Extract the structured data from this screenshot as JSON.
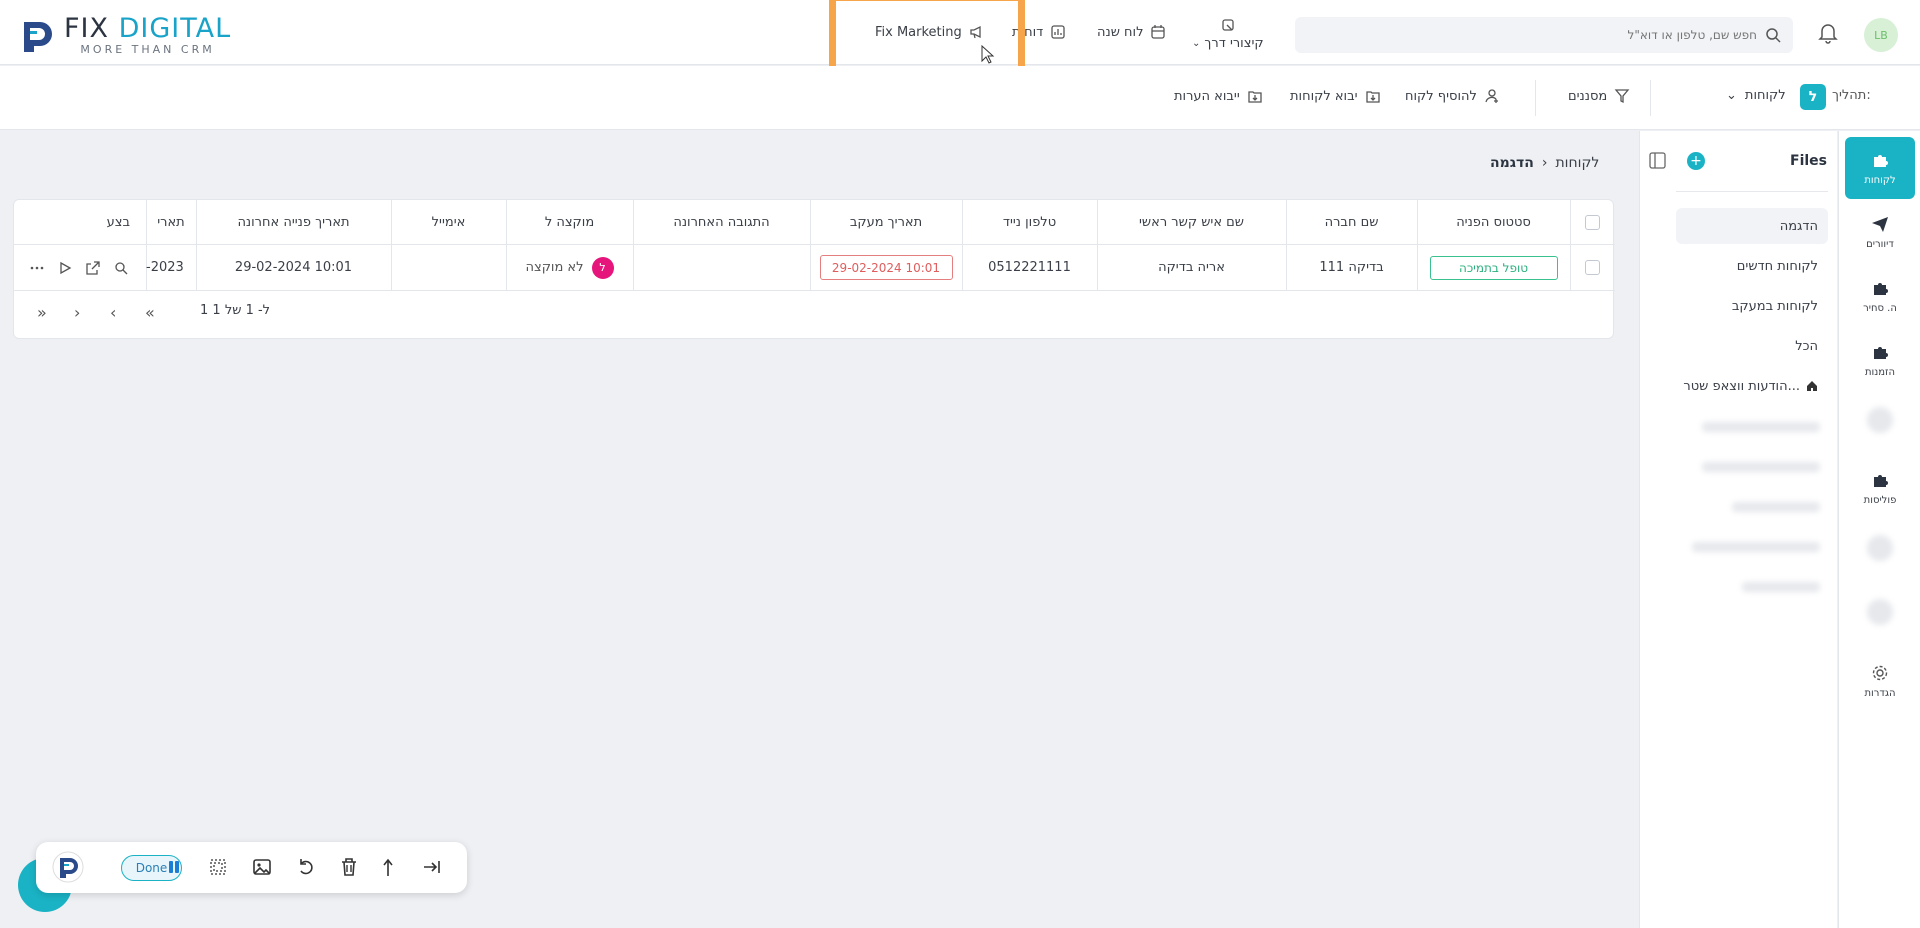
{
  "header": {
    "logo_brand_a": "FIX",
    "logo_brand_b": "DIGITAL",
    "logo_tagline": "MORE THAN CRM",
    "nav": [
      {
        "label": "Fix Marketing",
        "icon": "megaphone-icon"
      },
      {
        "label": "דוחות",
        "icon": "chart-icon"
      },
      {
        "label": "לוח שנה",
        "icon": "calendar-icon"
      },
      {
        "label": "קיצורי דרך",
        "icon": "shortcut-icon"
      }
    ],
    "search_placeholder": "חפש שם, טלפון או דוא\"ל",
    "avatar_initials": "LB"
  },
  "actionbar": {
    "process_label": "תהליך:",
    "process_chip": "ל",
    "process_name": "לקוחות",
    "filters": "מסננים",
    "add_customer": "להוסיף לקוח",
    "import_customers": "יבוא לקוחות",
    "import_notes": "ייבוא הערות"
  },
  "rail": [
    {
      "label": "לקוחות",
      "icon": "puzzle-icon",
      "active": true
    },
    {
      "label": "דיוורים",
      "icon": "send-icon"
    },
    {
      "label": "ה. סחיר",
      "icon": "puzzle-icon"
    },
    {
      "label": "הזמנות",
      "icon": "puzzle-icon"
    },
    {
      "label": "פוליסות",
      "icon": "puzzle-icon"
    },
    {
      "label": "הגדרות",
      "icon": "gear-icon"
    }
  ],
  "files_panel": {
    "title": "Files",
    "items": [
      "הדגמה",
      "לקוחות חדשים",
      "לקוחות במעקב",
      "הכל",
      "הודעות ווצאפ שטר..."
    ]
  },
  "breadcrumb": {
    "parent": "לקוחות",
    "current": "הדגמה"
  },
  "table": {
    "headers": {
      "status": "סטטוס הפניה",
      "company": "שם חברה",
      "contact": "שם איש קשר ראשי",
      "phone": "טלפון נייד",
      "followup": "תאריך מעקב",
      "last_response": "התגובה האחרונה",
      "assigned": "מוקצה ל",
      "email": "אימייל",
      "last_contact": "תאריך פנייה אחרונה",
      "date": "תארי",
      "actions": "בצע"
    },
    "row": {
      "status": "טופל בתמיכה",
      "company": "בדיקה 111",
      "contact": "אריה בדיקה",
      "phone": "0512221111",
      "followup": "29-02-2024 10:01",
      "last_response": "",
      "assigned_initial": "ל",
      "assigned": "לא מוקצה",
      "email": "",
      "last_contact": "29-02-2024 10:01",
      "date": "-2023"
    },
    "pager_text": "1 ל- 1 של 1"
  },
  "float_toolbar": {
    "done_label": "Done"
  },
  "colors": {
    "accent": "#1ab3c5",
    "highlight": "#f7a54a",
    "status_green": "#39c28f",
    "date_red": "#e05d5d",
    "assign_pink": "#e6157c"
  }
}
